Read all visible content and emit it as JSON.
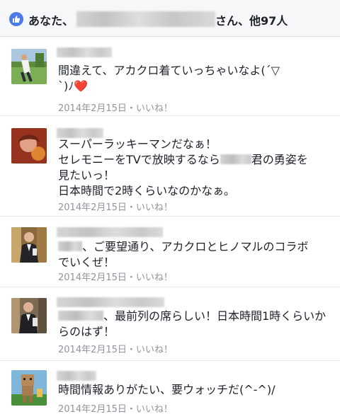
{
  "likes": {
    "prefix": "あなた、",
    "suffix": "さん、他97人",
    "badge_color": "#4b7be5",
    "icon": "thumbs-up-icon"
  },
  "comments": [
    {
      "text_line1": "間違えて、アカクロ着ていっちゃいなよ(´▽",
      "text_line2": "`)ﾉ",
      "emoji": "❤️",
      "date": "2014年2月15日",
      "separator": "・",
      "like_label": "いいね！"
    },
    {
      "text_line1": "スーパーラッキーマンだなぁ！",
      "text_line2a": "セレモニーをTVで放映するなら",
      "text_line2b": "君の勇姿を",
      "text_line3": "見たいっ！",
      "text_line4": "日本時間で2時くらいなのかなぁ。",
      "date": "2014年2月15日",
      "separator": "・",
      "like_label": "いいね！"
    },
    {
      "text_line1": "、ご要望通り、アカクロとヒノマルのコラボ",
      "text_line2": "でいくぜ！",
      "date": "2014年2月15日",
      "separator": "・",
      "like_label": "いいね！"
    },
    {
      "text_line1": "、最前列の席らしい！日本時間1時くらいか",
      "text_line2": "らのはず！",
      "date": "2014年2月15日",
      "separator": "・",
      "like_label": "いいね！"
    },
    {
      "text_line1": "時間情報ありがたい、要ウォッチだ(^-^)/",
      "date": "2014年2月15日",
      "separator": "・",
      "like_label": "いいね！"
    }
  ]
}
